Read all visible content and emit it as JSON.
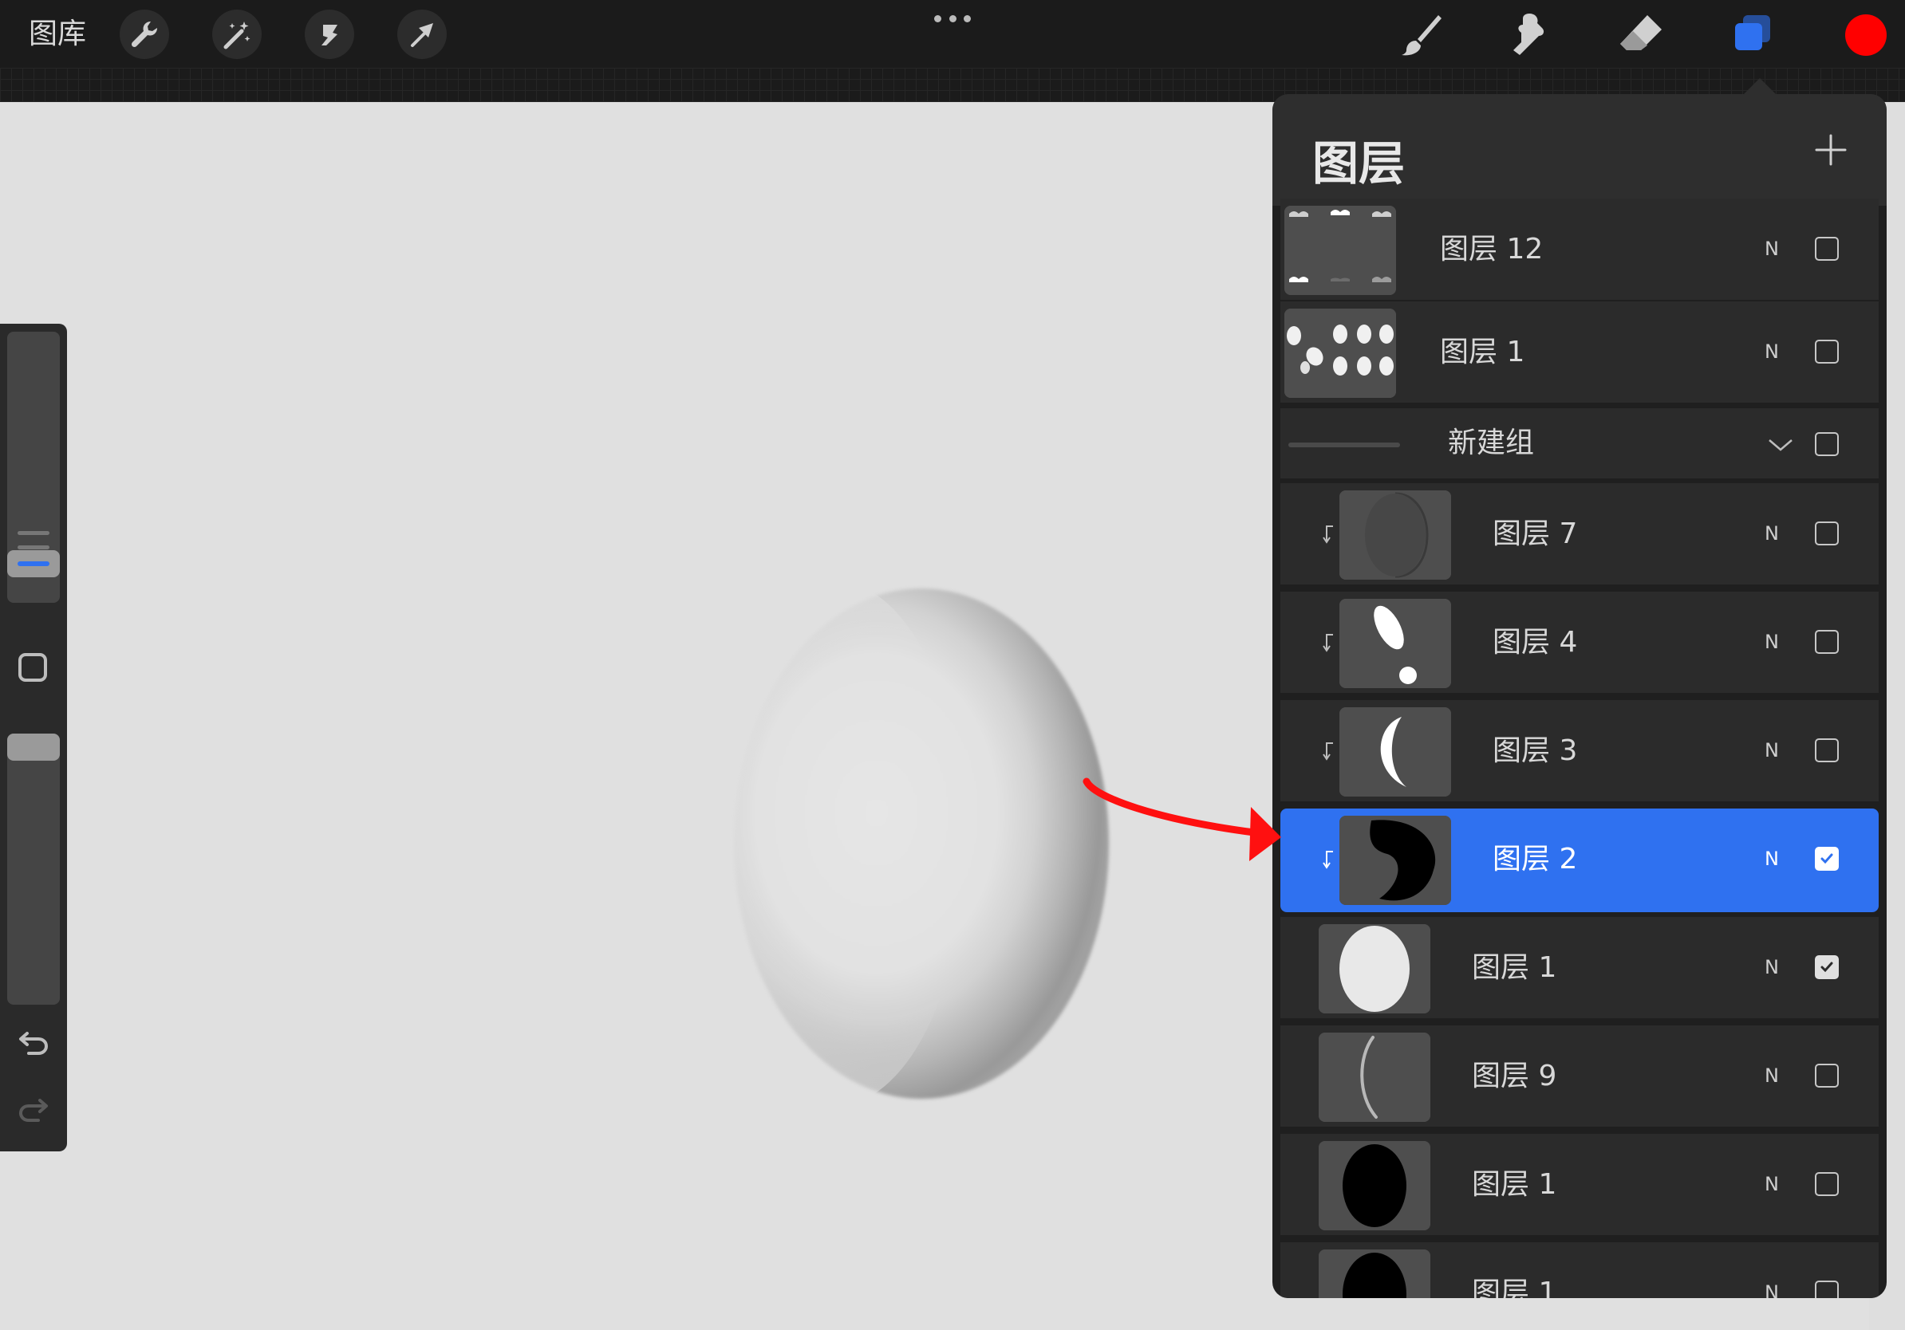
{
  "toolbar": {
    "gallery_label": "图库",
    "tools": [
      {
        "name": "wrench-icon"
      },
      {
        "name": "magic-wand-icon"
      },
      {
        "name": "selection-icon"
      },
      {
        "name": "transform-arrow-icon"
      }
    ],
    "right_tools": [
      "brush-icon",
      "smudge-icon",
      "eraser-icon",
      "layers-icon"
    ],
    "active_color": "#ff0000",
    "accent_color": "#2f71f0"
  },
  "layers_panel": {
    "title": "图层",
    "layers": [
      {
        "name": "图层 12",
        "blend": "N",
        "visible": false,
        "clipped": false,
        "indent": false,
        "thumb": "smudge-strips"
      },
      {
        "name": "图层 1",
        "blend": "N",
        "visible": false,
        "clipped": false,
        "indent": false,
        "thumb": "white-blobs"
      },
      {
        "name": "新建组",
        "type": "group",
        "visible": false
      },
      {
        "name": "图层 7",
        "blend": "N",
        "visible": false,
        "clipped": true,
        "indent": true,
        "thumb": "dark-circle"
      },
      {
        "name": "图层 4",
        "blend": "N",
        "visible": false,
        "clipped": true,
        "indent": true,
        "thumb": "white-highlight"
      },
      {
        "name": "图层 3",
        "blend": "N",
        "visible": false,
        "clipped": true,
        "indent": true,
        "thumb": "white-crescent"
      },
      {
        "name": "图层 2",
        "blend": "N",
        "visible": true,
        "clipped": true,
        "indent": true,
        "selected": true,
        "thumb": "black-crescent"
      },
      {
        "name": "图层 1",
        "blend": "N",
        "visible": true,
        "clipped": false,
        "indent": true,
        "thumb": "white-ellipse"
      },
      {
        "name": "图层 9",
        "blend": "N",
        "visible": false,
        "clipped": false,
        "indent": true,
        "thumb": "thin-arc"
      },
      {
        "name": "图层 1",
        "blend": "N",
        "visible": false,
        "clipped": false,
        "indent": true,
        "thumb": "black-ellipse"
      },
      {
        "name": "图层 1",
        "blend": "N",
        "visible": false,
        "clipped": false,
        "indent": true,
        "thumb": "black-ellipse-partial"
      }
    ]
  }
}
